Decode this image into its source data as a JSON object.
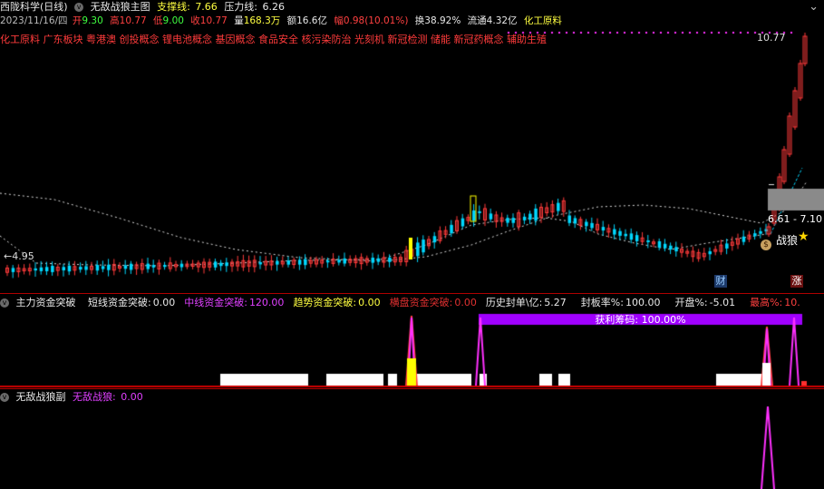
{
  "header": {
    "title": "西陇科学(日线)",
    "indicator": "无敌战狼主图",
    "support_label": "支撑线:",
    "support_value": "7.66",
    "pressure_label": "压力线:",
    "pressure_value": "6.26"
  },
  "quote": {
    "date": "2023/11/16/四",
    "open_label": "开",
    "open": "9.30",
    "high_label": "高",
    "high": "10.77",
    "low_label": "低",
    "low": "9.00",
    "close_label": "收",
    "close": "10.77",
    "volume_label": "量",
    "volume": "168.3万",
    "amount_label": "额",
    "amount": "16.6亿",
    "change_label": "幅",
    "change": "0.98(10.01%)",
    "turnover_label": "换",
    "turnover": "38.92%",
    "float_label": "流通",
    "float": "4.32亿",
    "industry": "化工原料"
  },
  "concepts": "化工原料 广东板块 粤港澳 创投概念 锂电池概念 基因概念 食品安全 核污染防治 光刻机 新冠检测 储能 新冠药概念 辅助生殖",
  "main_chart": {
    "high_price_label": "10.77",
    "low_price_label": "←4.95",
    "range_label": "6.61 - 7.10",
    "zhanlang_label": "战狼",
    "star": "★",
    "coin": "$",
    "cai_label": "财",
    "zhang_label": "涨"
  },
  "panel2": {
    "title": "主力资金突破",
    "items": [
      {
        "label": "短线资金突破:",
        "value": "0.00",
        "color": "#e8e8e8"
      },
      {
        "label": "中线资金突破:",
        "value": "120.00",
        "color": "#e040ff"
      },
      {
        "label": "趋势资金突破:",
        "value": "0.00",
        "color": "#ffff40"
      },
      {
        "label": "横盘资金突破:",
        "value": "0.00",
        "color": "#e03030"
      }
    ],
    "stats": [
      {
        "label": "历史封单\\亿:",
        "value": "5.27",
        "color": "#e8e8e8"
      },
      {
        "label": "封板率%:",
        "value": "100.00",
        "color": "#e8e8e8"
      },
      {
        "label": "开盘%:",
        "value": "-5.01",
        "color": "#e8e8e8"
      },
      {
        "label": "最高%:",
        "value": "10.",
        "color": "#ff4040"
      }
    ],
    "banner": "获利筹码: 100.00%"
  },
  "panel3": {
    "title": "无敌战狼副",
    "label": "无敌战狼:",
    "value": "0.00"
  },
  "colors": {
    "up": "#ff3b3b",
    "down": "#00d8ff",
    "ma": "#e8e8e8",
    "magenta": "#ff30ff",
    "purple": "#a000ff",
    "yellow": "#ffff00",
    "grid_red": "#b00000"
  }
}
